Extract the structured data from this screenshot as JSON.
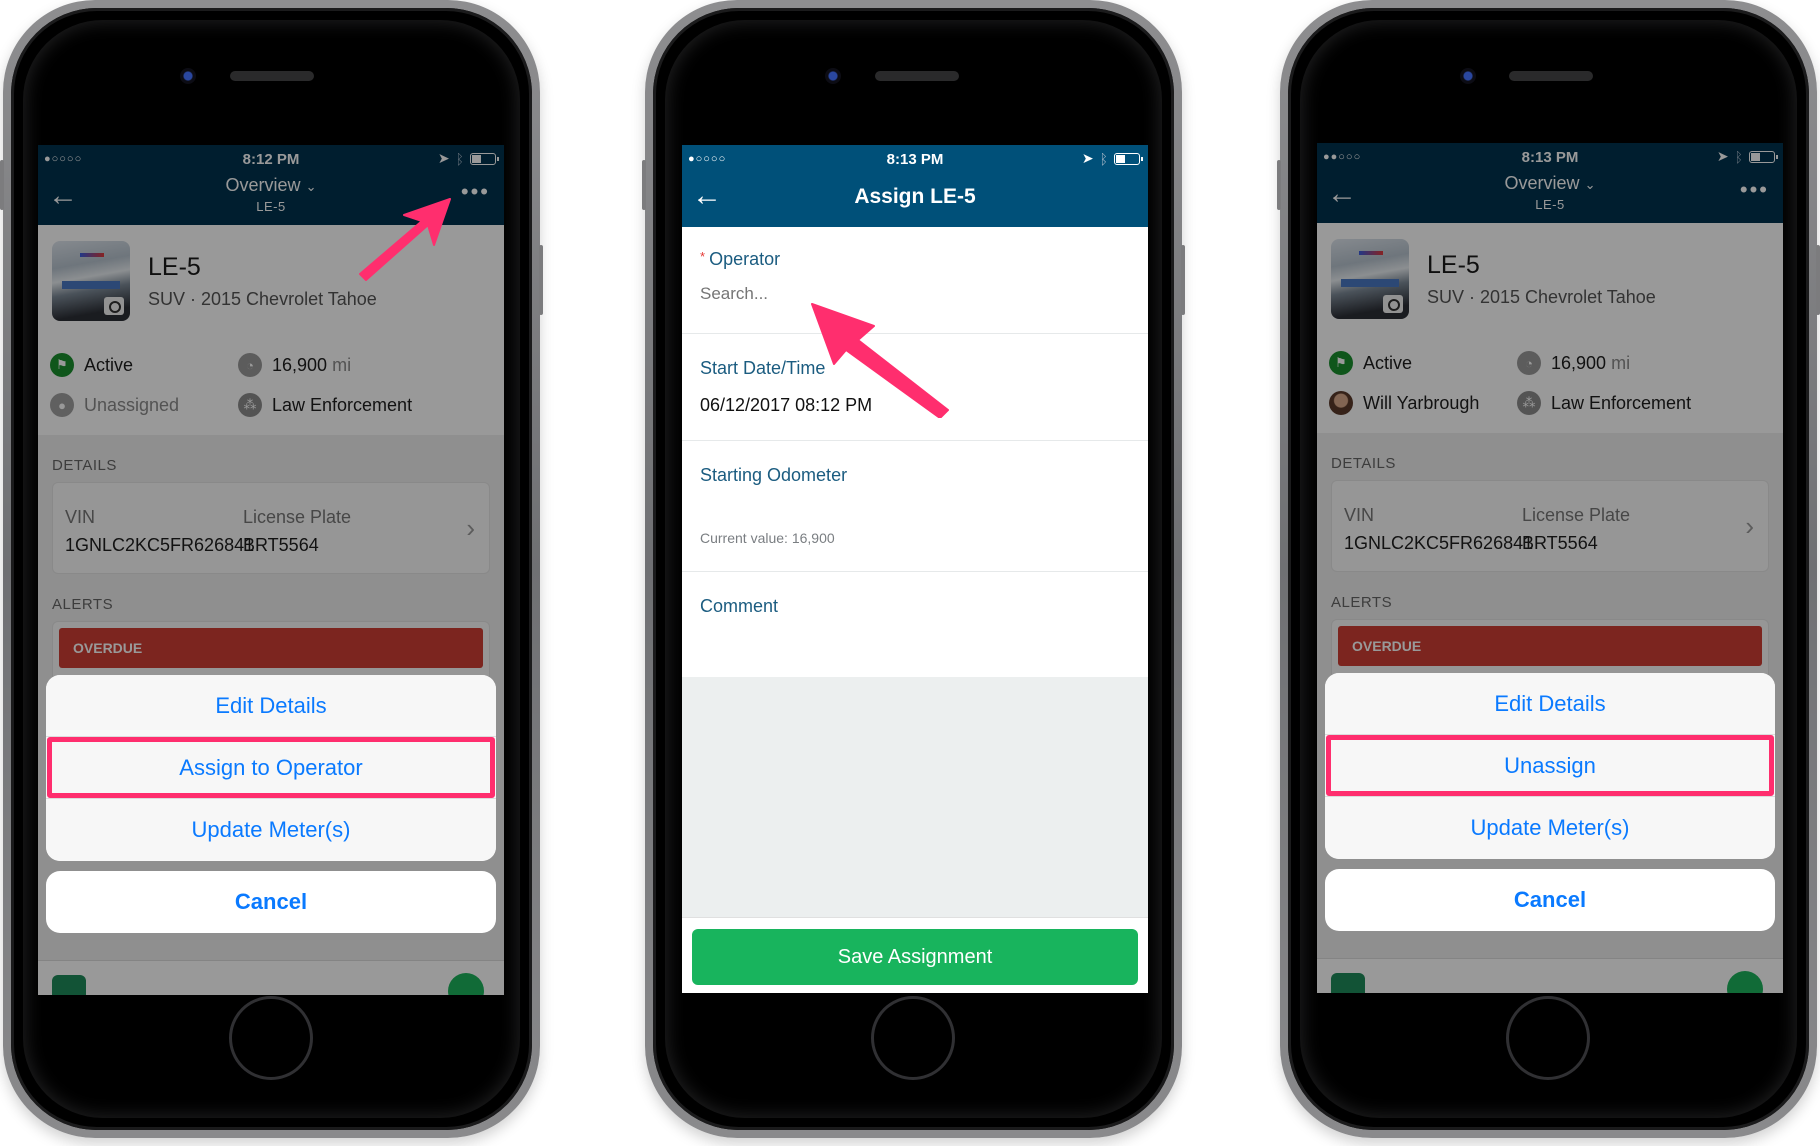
{
  "colors": {
    "nav_dark": "#00324f",
    "nav_form": "#005079",
    "accent_blue": "#0a7aff",
    "highlight_pink": "#ff2e6e",
    "save_green": "#18b45d",
    "status_active_green": "#1a8f2e",
    "alert_red": "#cf3e35",
    "label_blue": "#1b5c80"
  },
  "phones": [
    {
      "status_bar": {
        "signal": "●○○○○",
        "time": "8:12 PM",
        "location_icon": "location-arrow-icon",
        "bluetooth_icon": "bluetooth-icon",
        "battery_icon": "battery-icon"
      },
      "nav": {
        "back_icon": "←",
        "title": "Overview",
        "title_chevron": "⌄",
        "subtitle": "LE-5",
        "more_icon": "•••"
      },
      "vehicle": {
        "name": "LE-5",
        "subtitle": "SUV · 2015 Chevrolet Tahoe",
        "status": "Active",
        "meter_value": "16,900",
        "meter_unit": "mi",
        "operator": "Unassigned",
        "group": "Law Enforcement"
      },
      "details": {
        "section_label": "DETAILS",
        "vin_label": "VIN",
        "vin_value": "1GNLC2KC5FR626841",
        "plate_label": "License Plate",
        "plate_value": "BRT5564"
      },
      "alerts": {
        "section_label": "ALERTS",
        "banner": "OVERDUE"
      },
      "action_sheet": {
        "items": [
          "Edit Details",
          "Assign to Operator",
          "Update Meter(s)"
        ],
        "highlighted_index": 1,
        "cancel": "Cancel"
      }
    },
    {
      "status_bar": {
        "signal": "●○○○○",
        "time": "8:13 PM"
      },
      "nav": {
        "back_icon": "←",
        "title": "Assign LE-5"
      },
      "form": {
        "operator_required_mark": "*",
        "operator_label": "Operator",
        "operator_placeholder": "Search...",
        "start_label": "Start Date/Time",
        "start_value": "06/12/2017 08:12 PM",
        "odometer_label": "Starting Odometer",
        "odometer_hint": "Current value: 16,900",
        "comment_label": "Comment",
        "save_button": "Save Assignment"
      }
    },
    {
      "status_bar": {
        "signal": "●●○○○",
        "time": "8:13 PM"
      },
      "nav": {
        "back_icon": "←",
        "title": "Overview",
        "title_chevron": "⌄",
        "subtitle": "LE-5",
        "more_icon": "•••"
      },
      "vehicle": {
        "name": "LE-5",
        "subtitle": "SUV · 2015 Chevrolet Tahoe",
        "status": "Active",
        "meter_value": "16,900",
        "meter_unit": "mi",
        "operator": "Will Yarbrough",
        "group": "Law Enforcement"
      },
      "details": {
        "section_label": "DETAILS",
        "vin_label": "VIN",
        "vin_value": "1GNLC2KC5FR626841",
        "plate_label": "License Plate",
        "plate_value": "BRT5564"
      },
      "alerts": {
        "section_label": "ALERTS",
        "banner": "OVERDUE"
      },
      "action_sheet": {
        "items": [
          "Edit Details",
          "Unassign",
          "Update Meter(s)"
        ],
        "highlighted_index": 1,
        "cancel": "Cancel"
      }
    }
  ],
  "annotations": [
    {
      "phone": 1,
      "type": "arrow",
      "points_to": "more-options-button"
    },
    {
      "phone": 2,
      "type": "arrow",
      "points_to": "operator-search-input"
    }
  ]
}
